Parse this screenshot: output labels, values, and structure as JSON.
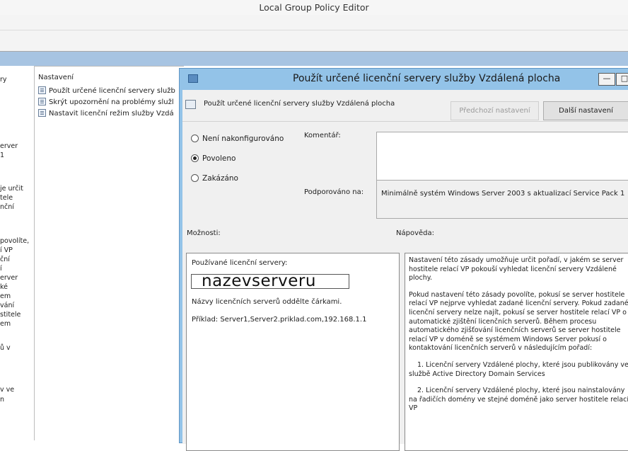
{
  "app": {
    "title": "Local Group Policy Editor"
  },
  "left_pane_fragments": [
    "ry",
    "erver",
    "1",
    "je určit",
    "tele",
    "nční",
    "povolíte,",
    "í VP",
    "ční",
    "í",
    "erver",
    "ké",
    "em",
    "vání",
    "stitele",
    "em",
    "ů v",
    "v ve",
    "n"
  ],
  "list": {
    "header": "Nastavení",
    "items": [
      "Použít určené licenční servery služb",
      "Skrýt upozornění na problémy služl",
      "Nastavit licenční režim služby Vzdá"
    ]
  },
  "dialog": {
    "title": "Použít určené licenční servery služby Vzdálená plocha",
    "minimize_label": "—",
    "maximize_label": "□",
    "setting_title": "Použít určené licenční servery služby Vzdálená plocha",
    "prev_button": "Předchozí nastavení",
    "next_button": "Další nastavení",
    "radios": {
      "not_configured": "Není nakonfigurováno",
      "enabled": "Povoleno",
      "disabled": "Zakázáno",
      "selected": "enabled"
    },
    "comment_label": "Komentář:",
    "supported_label": "Podporováno na:",
    "supported_value": "Minimálně systém Windows Server 2003 s aktualizací Service Pack 1",
    "options_label": "Možnosti:",
    "help_label": "Nápověda:",
    "options": {
      "servers_label": "Používané licenční servery:",
      "servers_value": "nazevserveru",
      "hint": "Názvy licenčních serverů oddělte čárkami.",
      "example": "Příklad: Server1,Server2.priklad.com,192.168.1.1"
    },
    "help_paragraphs": [
      "Nastavení této zásady umožňuje určit pořadí, v jakém se server hostitele relací VP pokouší vyhledat licenční servery Vzdálené plochy.",
      "Pokud nastavení této zásady povolíte, pokusí se server hostitele relací VP nejprve vyhledat zadané licenční servery. Pokud zadané licenční servery nelze najít, pokusí se server hostitele relací VP o automatické zjištění licenčních serverů. Během procesu automatického zjišťování licenčních serverů se server hostitele relací VP v doméně se systémem Windows Server pokusí o kontaktování licenčních serverů v následujícím pořadí:",
      "1. Licenční servery Vzdálené plochy, které jsou publikovány ve službě Active Directory Domain Services",
      "2. Licenční servery Vzdálené plochy, které jsou nainstalovány na řadičích domény ve stejné doméně jako server hostitele relací VP"
    ]
  }
}
